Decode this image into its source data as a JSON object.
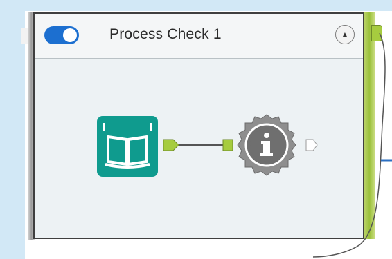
{
  "container": {
    "title": "Process Check 1",
    "enabled": true,
    "collapse_icon": "chevron-up-icon"
  },
  "tools": [
    {
      "name": "input-data-tool",
      "icon": "book-icon",
      "color": "#0f9b8e"
    },
    {
      "name": "browse-tool",
      "icon": "info-badge-icon",
      "color": "#6f6f6f"
    }
  ],
  "colors": {
    "canvas_bg": "#d2e8f6",
    "container_bg": "#edf2f4",
    "toggle_on": "#1c6fd0",
    "anchor_green": "#a6cc3f",
    "connector_line": "#555555"
  },
  "glyphs": {
    "collapse": "▲",
    "info": "i"
  }
}
